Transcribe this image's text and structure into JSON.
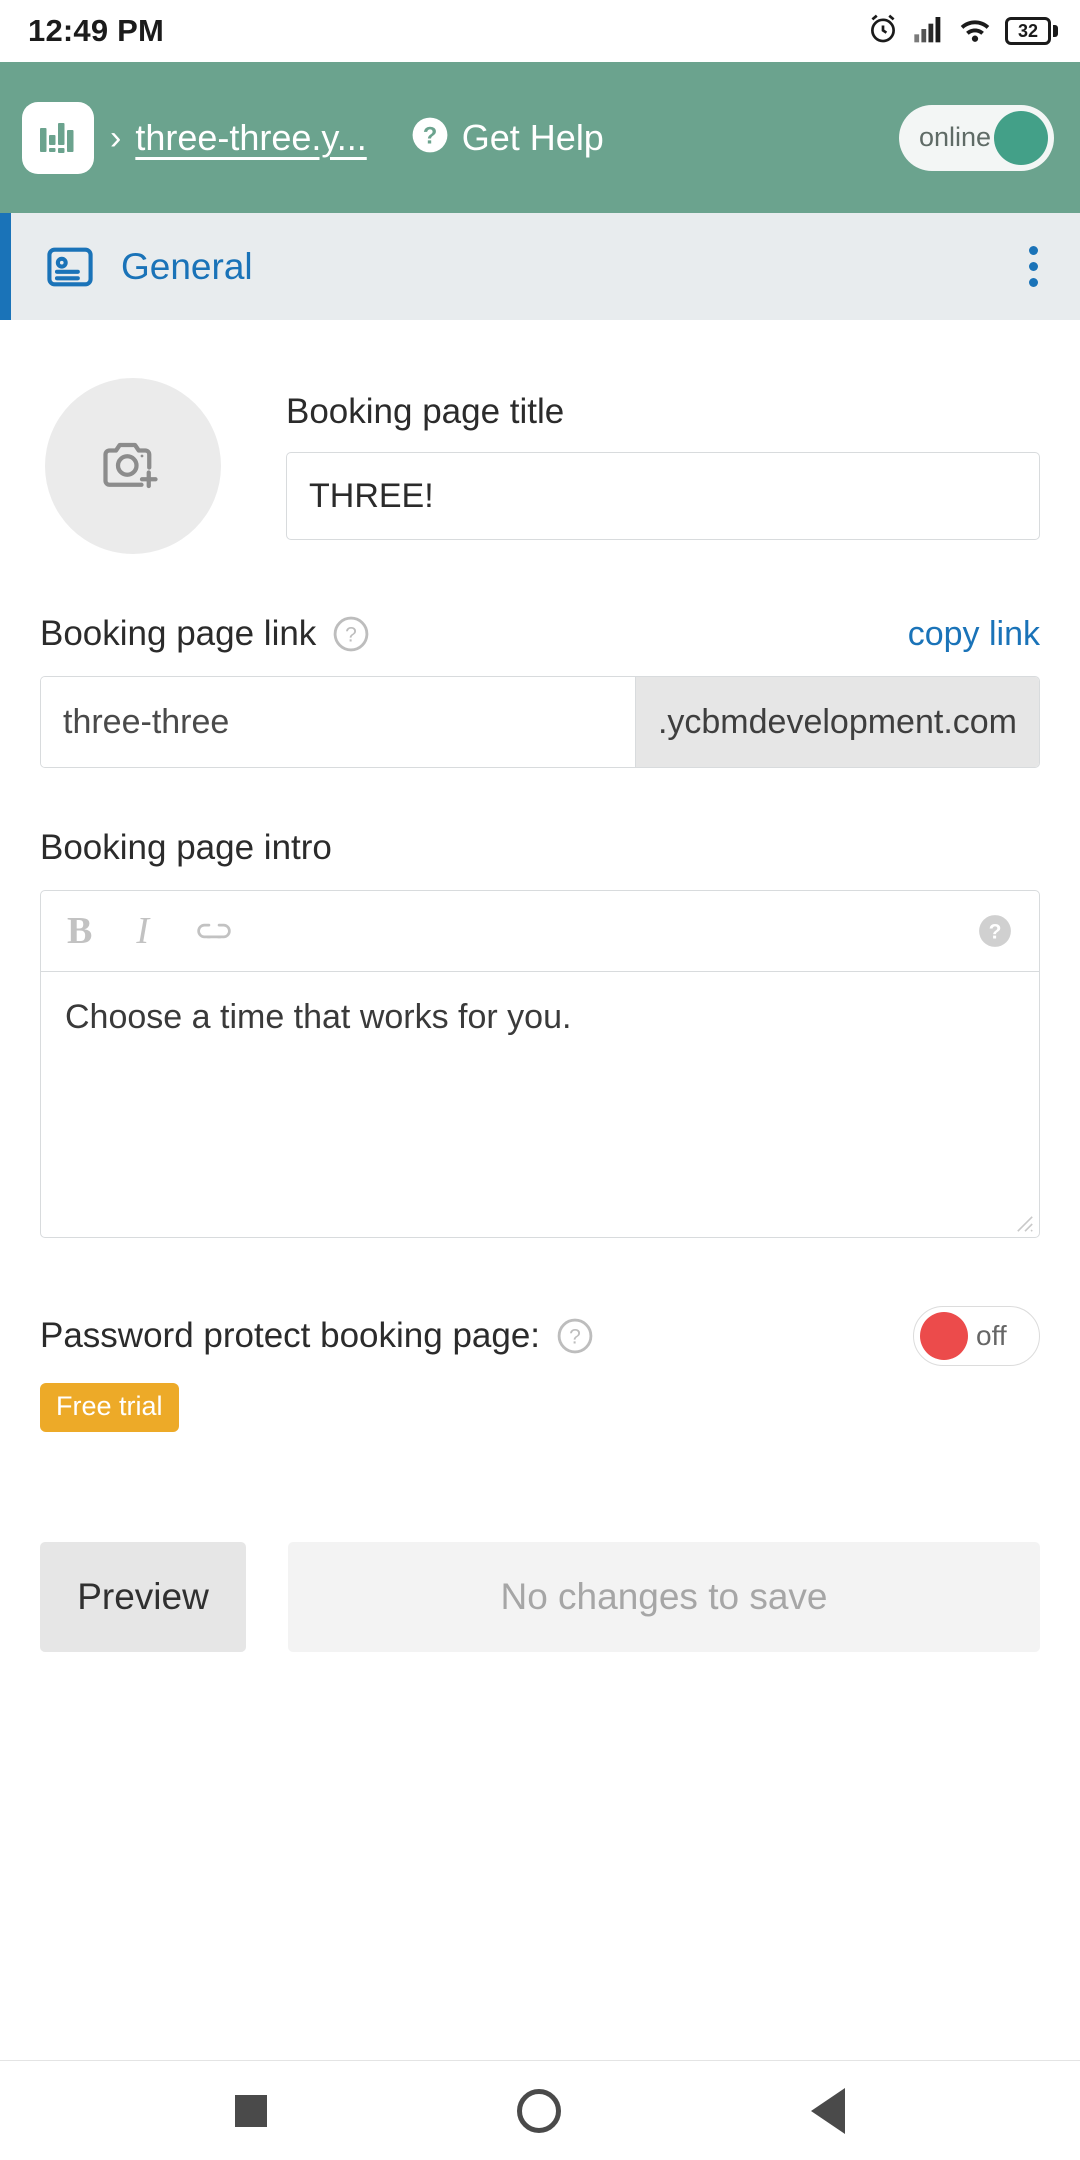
{
  "statusbar": {
    "time": "12:49 PM",
    "battery_level": "32",
    "icons": [
      "alarm-icon",
      "cellular-signal-icon",
      "wifi-icon",
      "battery-icon"
    ]
  },
  "appbar": {
    "logo_icon": "bar-chart-logo-icon",
    "breadcrumb_separator": "›",
    "breadcrumb_link": "three-three.y...",
    "help_icon": "question-mark-circle-icon",
    "help_label": "Get Help",
    "status_toggle": {
      "label": "online",
      "state": "on",
      "knob_color": "#43a088"
    },
    "background_color": "#6ba38e"
  },
  "tabbar": {
    "icon": "contact-card-icon",
    "label": "General",
    "accent_color": "#1a73b8",
    "overflow_icon": "kebab-menu-icon",
    "background_color": "#e8ecee"
  },
  "main": {
    "avatar": {
      "icon": "add-photo-camera-icon",
      "background_color": "#ebebeb"
    },
    "title_field": {
      "label": "Booking page title",
      "value": "THREE!"
    },
    "link_section": {
      "label": "Booking page link",
      "help_icon": "question-mark-circle-icon",
      "copy_link_label": "copy link",
      "slug_value": "three-three",
      "domain_suffix": ".ycbmdevelopment.com"
    },
    "intro_section": {
      "label": "Booking page intro",
      "toolbar": {
        "bold_label": "B",
        "italic_label": "I",
        "link_icon": "link-chain-icon",
        "help_icon": "question-mark-circle-icon"
      },
      "body_text": "Choose a time that works for you."
    },
    "password_section": {
      "label": "Password protect booking page:",
      "help_icon": "question-mark-circle-icon",
      "toggle": {
        "label": "off",
        "state": "off",
        "knob_color": "#ec4b4b"
      },
      "badge": {
        "label": "Free trial",
        "color": "#edaa28"
      }
    },
    "actions": {
      "preview_label": "Preview",
      "save_label": "No changes to save"
    }
  },
  "navbar": {
    "recents_icon": "square-recents-icon",
    "home_icon": "circle-home-icon",
    "back_icon": "triangle-back-icon"
  }
}
